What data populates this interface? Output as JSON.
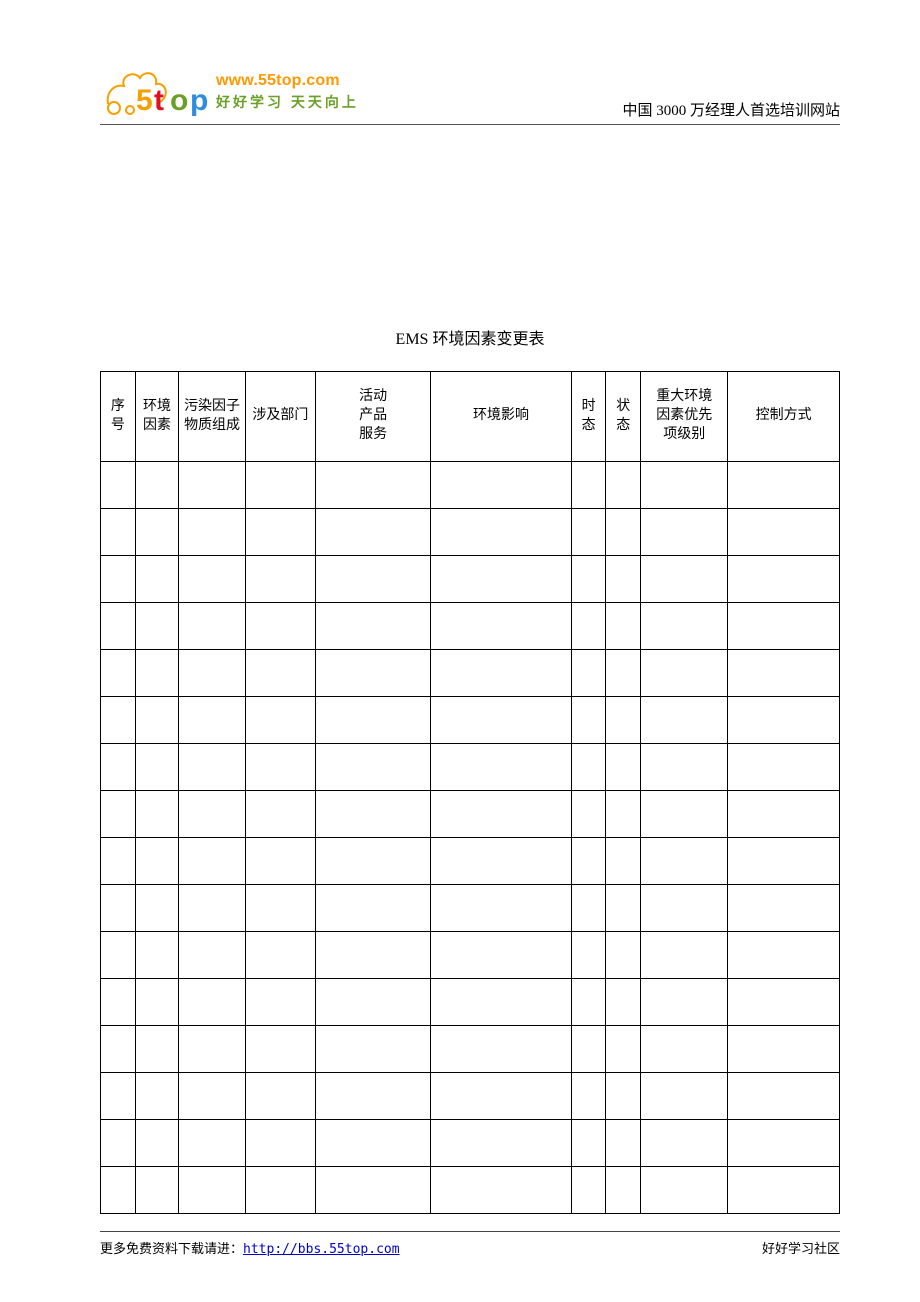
{
  "header": {
    "logo_url": "www.55top.com",
    "logo_tagline": "好好学习 天天向上",
    "right_text": "中国 3000 万经理人首选培训网站"
  },
  "title": "EMS 环境因素变更表",
  "table": {
    "headers": [
      "序号",
      "环境因素",
      "污染因子物质组成",
      "涉及部门",
      "活动\n产品\n服务",
      "环境影响",
      "时态",
      "状态",
      "重大环境因素优先项级别",
      "控制方式"
    ],
    "row_count": 16
  },
  "footer": {
    "left_prefix": "更多免费资料下载请进：",
    "link_text": "http://bbs.55top.com",
    "right_text": "好好学习社区"
  }
}
